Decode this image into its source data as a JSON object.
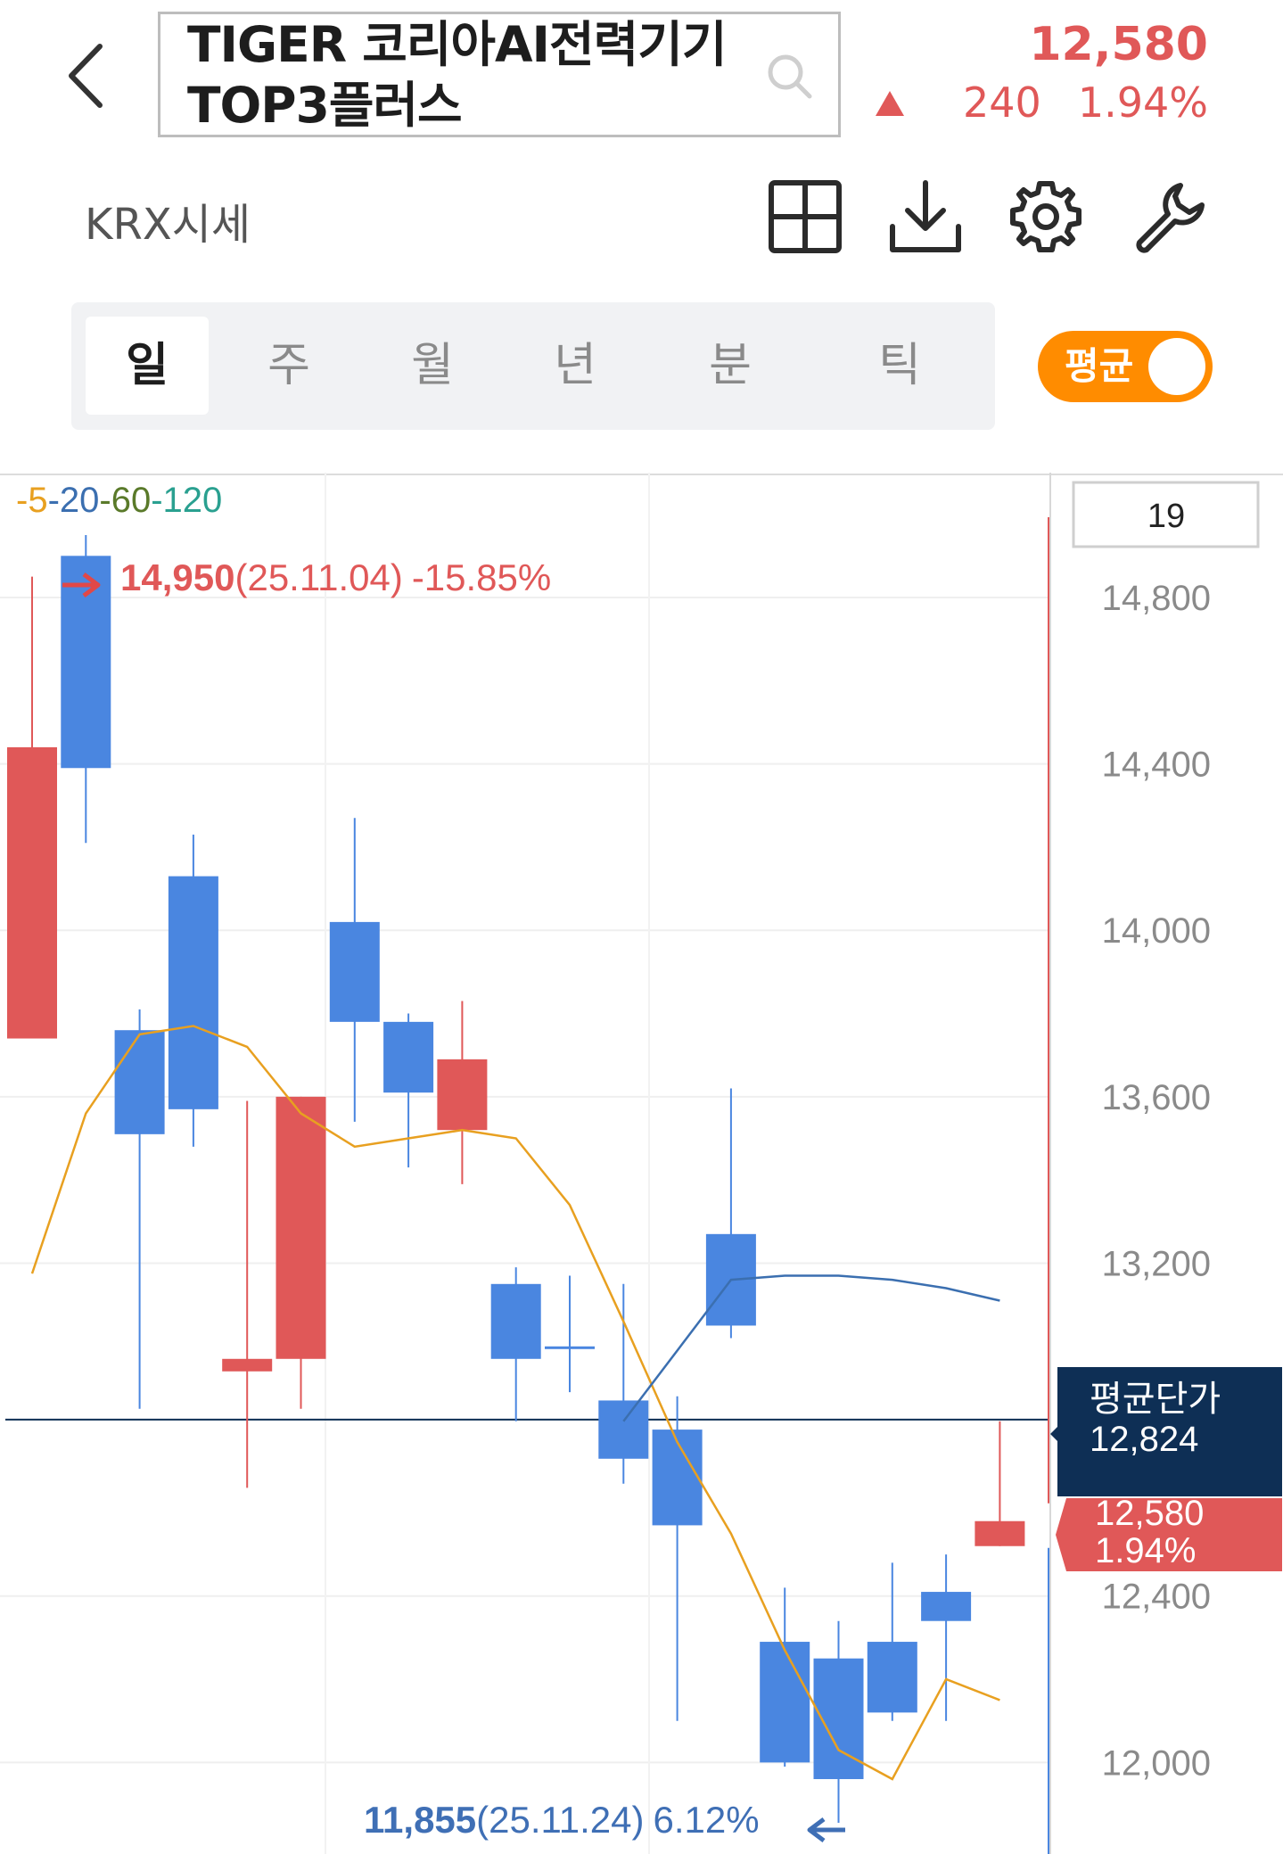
{
  "header": {
    "stock_name": "TIGER 코리아AI전력기기 TOP3플러스",
    "price": "12,580",
    "change": "240",
    "change_pct": "1.94%",
    "market_label": "KRX시세"
  },
  "icons": [
    "back-icon",
    "search-icon",
    "grid-icon",
    "download-icon",
    "gear-icon",
    "wrench-icon",
    "up-triangle-icon",
    "arrow-right-icon",
    "arrow-left-icon"
  ],
  "colors": {
    "up": "#e05858",
    "down": "#4a86e0",
    "ma5": "#e8a020",
    "ma20": "#3b6fb0",
    "accent": "#ff8c00",
    "avg_line": "#0e2f55"
  },
  "period_tabs": [
    {
      "label": "일",
      "active": true
    },
    {
      "label": "주",
      "active": false
    },
    {
      "label": "월",
      "active": false
    },
    {
      "label": "년",
      "active": false
    },
    {
      "label": "분",
      "active": false
    },
    {
      "label": "틱",
      "active": false
    }
  ],
  "avg_toggle": {
    "label": "평균",
    "on": true
  },
  "chart": {
    "ma_legend": [
      {
        "text": "-5",
        "color": "#e8a020"
      },
      {
        "text": "-20",
        "color": "#3b6fb0"
      },
      {
        "text": "-60",
        "color": "#5a7a2a"
      },
      {
        "text": "-120",
        "color": "#2aa090"
      }
    ],
    "count_box": "19",
    "high_annotation": {
      "price": "14,950",
      "date": "(25.11.04)",
      "pct": "-15.85%"
    },
    "low_annotation": {
      "price": "11,855",
      "date": "(25.11.24)",
      "pct": "6.12%"
    },
    "avg_price_label": "평균단가",
    "avg_price_value": "12,824",
    "current_label_price": "12,580",
    "current_label_pct": "1.94%"
  },
  "chart_data": {
    "type": "candlestick",
    "y_ticks": [
      "14,800",
      "14,400",
      "14,000",
      "13,600",
      "13,200",
      "12,400",
      "12,000"
    ],
    "ylim": [
      11780,
      15100
    ],
    "avg_price": 12824,
    "candles": [
      {
        "o": 13740,
        "h": 14850,
        "l": 13740,
        "c": 14440,
        "dir": "up"
      },
      {
        "o": 14900,
        "h": 14950,
        "l": 14210,
        "c": 14390,
        "dir": "down"
      },
      {
        "o": 13760,
        "h": 13810,
        "l": 12850,
        "c": 13510,
        "dir": "down"
      },
      {
        "o": 14130,
        "h": 14230,
        "l": 13480,
        "c": 13570,
        "dir": "down"
      },
      {
        "o": 12940,
        "h": 13590,
        "l": 12660,
        "c": 12970,
        "dir": "up"
      },
      {
        "o": 12970,
        "h": 13600,
        "l": 12850,
        "c": 13600,
        "dir": "up"
      },
      {
        "o": 14020,
        "h": 14270,
        "l": 13540,
        "c": 13780,
        "dir": "down"
      },
      {
        "o": 13780,
        "h": 13800,
        "l": 13430,
        "c": 13610,
        "dir": "down"
      },
      {
        "o": 13520,
        "h": 13830,
        "l": 13390,
        "c": 13690,
        "dir": "up"
      },
      {
        "o": 13150,
        "h": 13190,
        "l": 12820,
        "c": 12970,
        "dir": "down"
      },
      {
        "o": 13000,
        "h": 13170,
        "l": 12890,
        "c": 13000,
        "dir": "down"
      },
      {
        "o": 12870,
        "h": 13150,
        "l": 12670,
        "c": 12730,
        "dir": "down"
      },
      {
        "o": 12800,
        "h": 12880,
        "l": 12100,
        "c": 12570,
        "dir": "down"
      },
      {
        "o": 13270,
        "h": 13620,
        "l": 13020,
        "c": 13050,
        "dir": "down"
      },
      {
        "o": 12290,
        "h": 12420,
        "l": 11990,
        "c": 12000,
        "dir": "down"
      },
      {
        "o": 12250,
        "h": 12340,
        "l": 11855,
        "c": 11960,
        "dir": "down"
      },
      {
        "o": 12290,
        "h": 12480,
        "l": 12100,
        "c": 12120,
        "dir": "down"
      },
      {
        "o": 12410,
        "h": 12500,
        "l": 12100,
        "c": 12340,
        "dir": "down"
      },
      {
        "o": 12520,
        "h": 12820,
        "l": 12520,
        "c": 12580,
        "dir": "up"
      }
    ],
    "ma5": [
      13175,
      13560,
      13750,
      13770,
      13720,
      13560,
      13480,
      13500,
      13520,
      13500,
      13340,
      13060,
      12770,
      12550,
      12270,
      12030,
      11960,
      12200,
      12150
    ],
    "ma20": [
      null,
      null,
      null,
      null,
      null,
      null,
      null,
      null,
      null,
      null,
      null,
      12820,
      12990,
      13160,
      13170,
      13170,
      13160,
      13140,
      13110
    ]
  }
}
